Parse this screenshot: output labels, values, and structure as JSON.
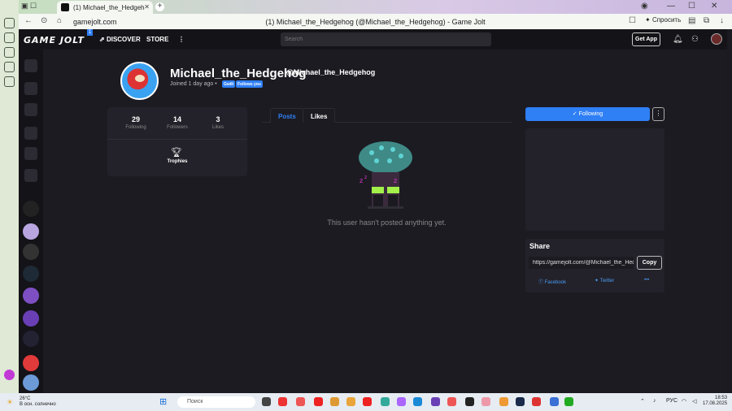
{
  "browser": {
    "tab_title": "(1) Michael_the_Hedgeh",
    "url": "gamejolt.com",
    "page_title": "(1) Michael_the_Hedgehog (@Michael_the_Hedgehog) - Game Jolt",
    "shield_label": "Спросить"
  },
  "site": {
    "logo": "GAME JOLT",
    "logo_badge": "1",
    "nav_discover": "DISCOVER",
    "nav_store": "STORE",
    "search_placeholder": "Search",
    "get_app": "Get App"
  },
  "profile": {
    "name": "Michael_the_Hedgehog",
    "handle": "@Michael_the_Hedgehog",
    "joined": "Joined 1 day ago",
    "badges": [
      "Gwilt",
      "Follows you"
    ]
  },
  "stats": [
    {
      "value": "29",
      "label": "Following"
    },
    {
      "value": "14",
      "label": "Followers"
    },
    {
      "value": "3",
      "label": "Likes"
    }
  ],
  "trophies_label": "Trophies",
  "tabs": [
    "Posts",
    "Likes"
  ],
  "empty_message": "This user hasn't posted anything yet.",
  "following_button": "Following",
  "share": {
    "title": "Share",
    "url": "https://gamejolt.com/@Michael_the_Hedgehog",
    "copy": "Copy",
    "facebook": "Facebook",
    "twitter": "Twitter",
    "more": "•••"
  },
  "taskbar": {
    "temp": "26°C",
    "weather": "В осн. солнечно",
    "search": "Поиск",
    "lang": "РУС",
    "time": "18:53",
    "date": "17.08.2025"
  },
  "colors": {
    "accent": "#2f7ff5",
    "bg": "#1c1b22",
    "panel": "#23222a"
  }
}
